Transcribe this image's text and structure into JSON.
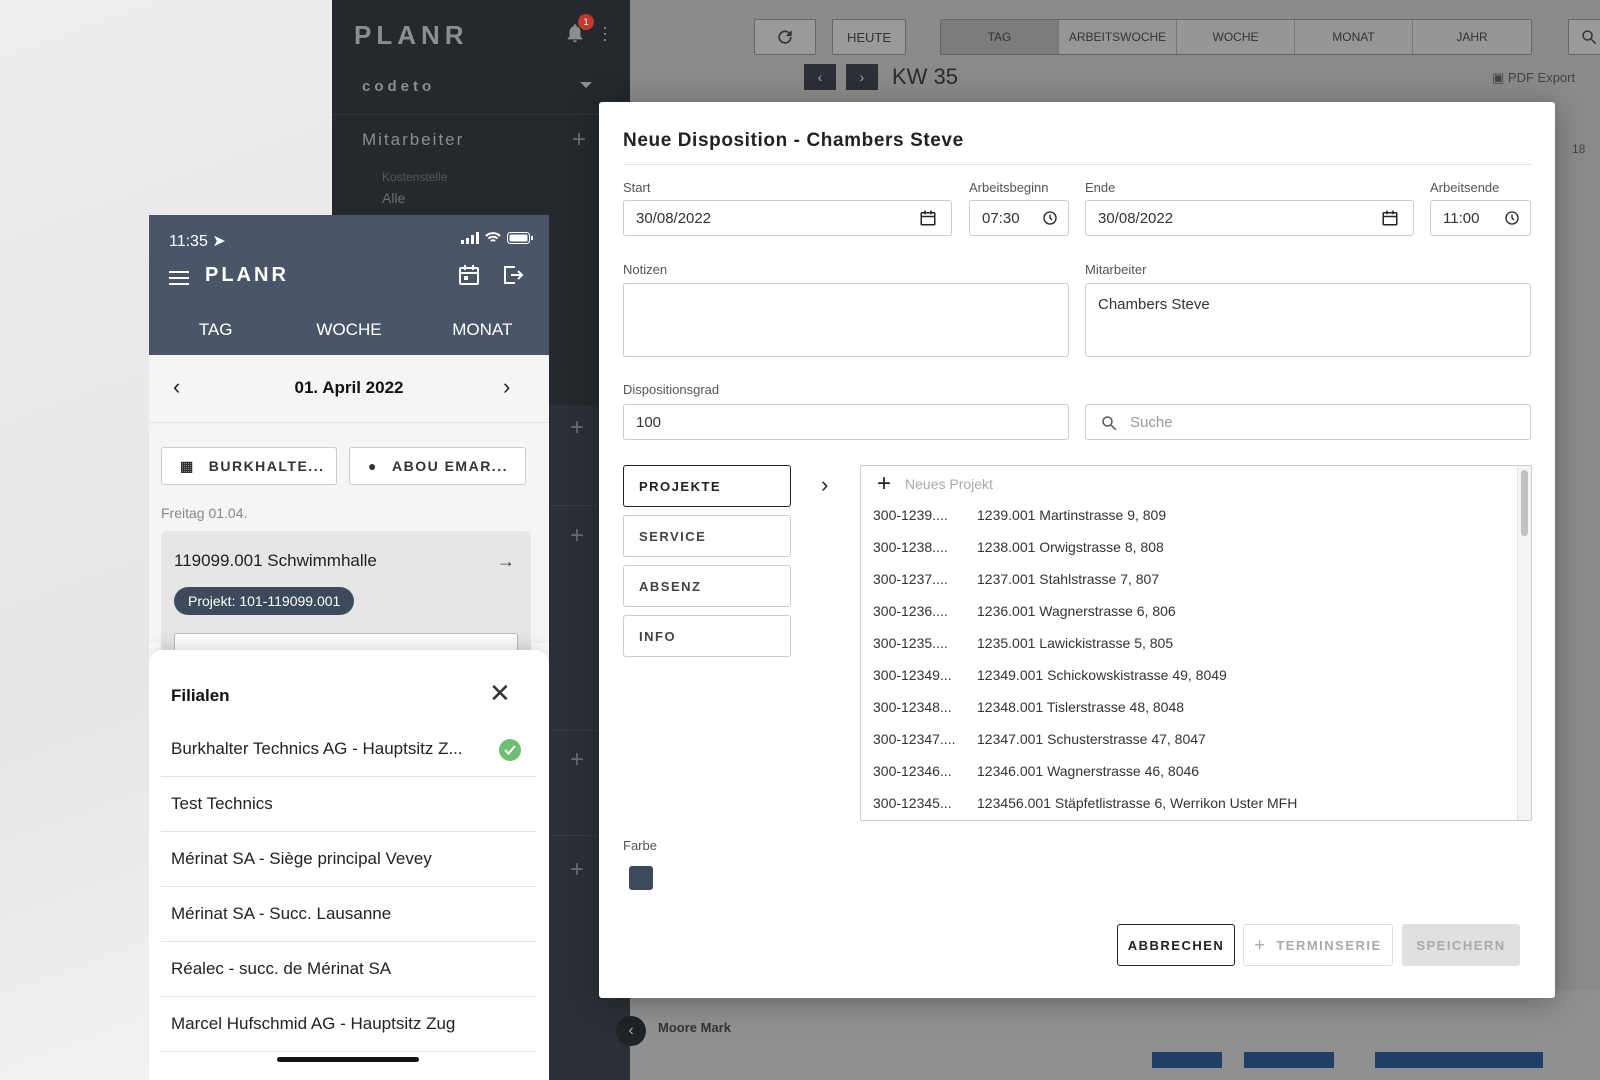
{
  "desktop": {
    "logo": "PLANR",
    "notification_count": "1",
    "org": "codeto",
    "section_title": "Mitarbeiter",
    "kostenstelle_label": "Kostenstelle",
    "kostenstelle_value": "Alle",
    "toolbar": {
      "heute": "HEUTE",
      "views": [
        "TAG",
        "ARBEITSWOCHE",
        "WOCHE",
        "MONAT",
        "JAHR"
      ],
      "active_view": "TAG",
      "week_label": "KW 35",
      "pdf_export": "PDF Export",
      "col_number": "18"
    },
    "rows": {
      "employee": "Moore Mark"
    }
  },
  "modal": {
    "title": "Neue Disposition - Chambers Steve",
    "start_label": "Start",
    "start_value": "30/08/2022",
    "arbeitsbeginn_label": "Arbeitsbeginn",
    "arbeitsbeginn_value": "07:30",
    "ende_label": "Ende",
    "ende_value": "30/08/2022",
    "arbeitsende_label": "Arbeitsende",
    "arbeitsende_value": "11:00",
    "notizen_label": "Notizen",
    "notizen_value": "",
    "mitarbeiter_label": "Mitarbeiter",
    "mitarbeiter_value": "Chambers Steve",
    "dispositionsgrad_label": "Dispositionsgrad",
    "dispositionsgrad_value": "100",
    "search_placeholder": "Suche",
    "categories": [
      "PROJEKTE",
      "SERVICE",
      "ABSENZ",
      "INFO"
    ],
    "active_category": "PROJEKTE",
    "new_project": "Neues Projekt",
    "projects": [
      {
        "code": "300-1239....",
        "name": "1239.001 Martinstrasse 9, 809"
      },
      {
        "code": "300-1238....",
        "name": "1238.001 Orwigstrasse 8, 808"
      },
      {
        "code": "300-1237....",
        "name": "1237.001 Stahlstrasse 7, 807"
      },
      {
        "code": "300-1236....",
        "name": "1236.001 Wagnerstrasse 6, 806"
      },
      {
        "code": "300-1235....",
        "name": "1235.001 Lawickistrasse 5, 805"
      },
      {
        "code": "300-12349...",
        "name": "12349.001 Schickowskistrasse 49, 8049"
      },
      {
        "code": "300-12348...",
        "name": "12348.001 Tislerstrasse 48, 8048"
      },
      {
        "code": "300-12347....",
        "name": "12347.001 Schusterstrasse 47, 8047"
      },
      {
        "code": "300-12346...",
        "name": "12346.001 Wagnerstrasse 46, 8046"
      },
      {
        "code": "300-12345...",
        "name": "123456.001 Stäpfetlistrasse 6, Werrikon Uster MFH"
      }
    ],
    "farbe_label": "Farbe",
    "farbe_color": "#3d4a5c",
    "cancel": "ABBRECHEN",
    "terminserie": "TERMINSERIE",
    "save": "SPEICHERN"
  },
  "mobile": {
    "time": "11:35",
    "logo": "PLANR",
    "tabs": [
      "TAG",
      "WOCHE",
      "MONAT"
    ],
    "date": "01. April 2022",
    "filter_branch": "BURKHALTE...",
    "filter_person": "ABOU EMAR...",
    "day_label": "Freitag 01.04.",
    "card_title": "119099.001 Schwimmhalle",
    "card_chip": "Projekt: 101-119099.001",
    "sheet_title": "Filialen",
    "branches": [
      "Burkhalter Technics AG - Hauptsitz Z...",
      "Test Technics",
      "Mérinat SA - Siège principal Vevey",
      "Mérinat SA - Succ. Lausanne",
      "Réalec - succ. de Mérinat SA",
      "Marcel Hufschmid AG - Hauptsitz Zug"
    ],
    "selected_branch": "Burkhalter Technics AG - Hauptsitz Z...",
    "header_color": "#4a5668",
    "check_color": "#6fbf73"
  }
}
